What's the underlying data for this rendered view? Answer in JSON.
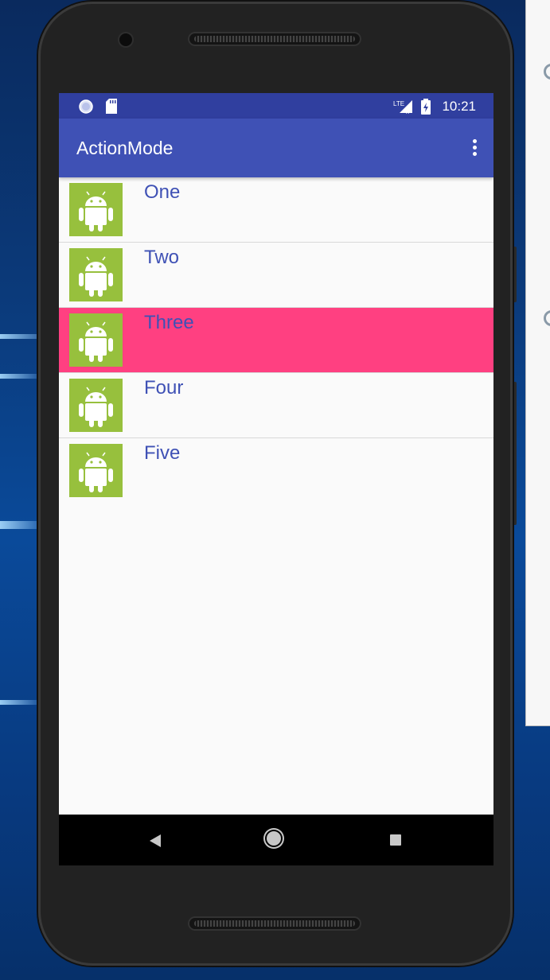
{
  "status_bar": {
    "time": "10:21",
    "icons": [
      "sync-circle-icon",
      "sd-card-icon",
      "lte-signal-icon",
      "battery-charging-icon"
    ]
  },
  "app_bar": {
    "title": "ActionMode",
    "overflow_icon": "more-vert-icon"
  },
  "list": {
    "items": [
      {
        "label": "One",
        "icon": "android-icon",
        "selected": false
      },
      {
        "label": "Two",
        "icon": "android-icon",
        "selected": false
      },
      {
        "label": "Three",
        "icon": "android-icon",
        "selected": true
      },
      {
        "label": "Four",
        "icon": "android-icon",
        "selected": false
      },
      {
        "label": "Five",
        "icon": "android-icon",
        "selected": false
      }
    ]
  },
  "nav_bar": {
    "icons": [
      "back-icon",
      "home-icon",
      "recents-icon"
    ]
  },
  "colors": {
    "primary": "#3f51b5",
    "primary_dark": "#303f9f",
    "accent": "#ff4081",
    "android_green": "#97c03d"
  }
}
